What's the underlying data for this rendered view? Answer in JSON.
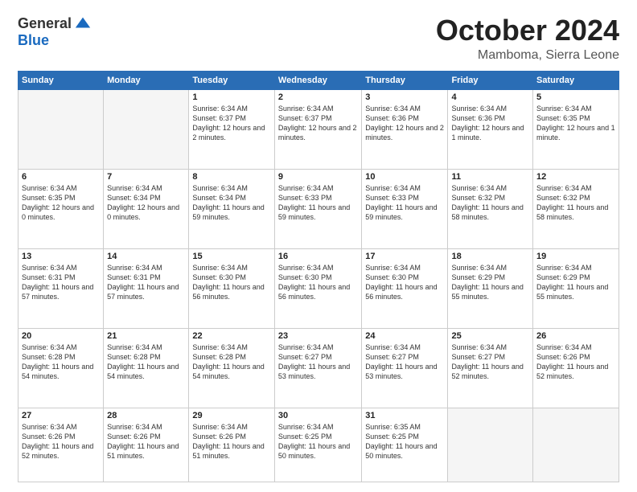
{
  "header": {
    "logo_general": "General",
    "logo_blue": "Blue",
    "month_title": "October 2024",
    "location": "Mamboma, Sierra Leone"
  },
  "days_of_week": [
    "Sunday",
    "Monday",
    "Tuesday",
    "Wednesday",
    "Thursday",
    "Friday",
    "Saturday"
  ],
  "weeks": [
    [
      {
        "day": "",
        "info": ""
      },
      {
        "day": "",
        "info": ""
      },
      {
        "day": "1",
        "info": "Sunrise: 6:34 AM\nSunset: 6:37 PM\nDaylight: 12 hours and 2 minutes."
      },
      {
        "day": "2",
        "info": "Sunrise: 6:34 AM\nSunset: 6:37 PM\nDaylight: 12 hours and 2 minutes."
      },
      {
        "day": "3",
        "info": "Sunrise: 6:34 AM\nSunset: 6:36 PM\nDaylight: 12 hours and 2 minutes."
      },
      {
        "day": "4",
        "info": "Sunrise: 6:34 AM\nSunset: 6:36 PM\nDaylight: 12 hours and 1 minute."
      },
      {
        "day": "5",
        "info": "Sunrise: 6:34 AM\nSunset: 6:35 PM\nDaylight: 12 hours and 1 minute."
      }
    ],
    [
      {
        "day": "6",
        "info": "Sunrise: 6:34 AM\nSunset: 6:35 PM\nDaylight: 12 hours and 0 minutes."
      },
      {
        "day": "7",
        "info": "Sunrise: 6:34 AM\nSunset: 6:34 PM\nDaylight: 12 hours and 0 minutes."
      },
      {
        "day": "8",
        "info": "Sunrise: 6:34 AM\nSunset: 6:34 PM\nDaylight: 11 hours and 59 minutes."
      },
      {
        "day": "9",
        "info": "Sunrise: 6:34 AM\nSunset: 6:33 PM\nDaylight: 11 hours and 59 minutes."
      },
      {
        "day": "10",
        "info": "Sunrise: 6:34 AM\nSunset: 6:33 PM\nDaylight: 11 hours and 59 minutes."
      },
      {
        "day": "11",
        "info": "Sunrise: 6:34 AM\nSunset: 6:32 PM\nDaylight: 11 hours and 58 minutes."
      },
      {
        "day": "12",
        "info": "Sunrise: 6:34 AM\nSunset: 6:32 PM\nDaylight: 11 hours and 58 minutes."
      }
    ],
    [
      {
        "day": "13",
        "info": "Sunrise: 6:34 AM\nSunset: 6:31 PM\nDaylight: 11 hours and 57 minutes."
      },
      {
        "day": "14",
        "info": "Sunrise: 6:34 AM\nSunset: 6:31 PM\nDaylight: 11 hours and 57 minutes."
      },
      {
        "day": "15",
        "info": "Sunrise: 6:34 AM\nSunset: 6:30 PM\nDaylight: 11 hours and 56 minutes."
      },
      {
        "day": "16",
        "info": "Sunrise: 6:34 AM\nSunset: 6:30 PM\nDaylight: 11 hours and 56 minutes."
      },
      {
        "day": "17",
        "info": "Sunrise: 6:34 AM\nSunset: 6:30 PM\nDaylight: 11 hours and 56 minutes."
      },
      {
        "day": "18",
        "info": "Sunrise: 6:34 AM\nSunset: 6:29 PM\nDaylight: 11 hours and 55 minutes."
      },
      {
        "day": "19",
        "info": "Sunrise: 6:34 AM\nSunset: 6:29 PM\nDaylight: 11 hours and 55 minutes."
      }
    ],
    [
      {
        "day": "20",
        "info": "Sunrise: 6:34 AM\nSunset: 6:28 PM\nDaylight: 11 hours and 54 minutes."
      },
      {
        "day": "21",
        "info": "Sunrise: 6:34 AM\nSunset: 6:28 PM\nDaylight: 11 hours and 54 minutes."
      },
      {
        "day": "22",
        "info": "Sunrise: 6:34 AM\nSunset: 6:28 PM\nDaylight: 11 hours and 54 minutes."
      },
      {
        "day": "23",
        "info": "Sunrise: 6:34 AM\nSunset: 6:27 PM\nDaylight: 11 hours and 53 minutes."
      },
      {
        "day": "24",
        "info": "Sunrise: 6:34 AM\nSunset: 6:27 PM\nDaylight: 11 hours and 53 minutes."
      },
      {
        "day": "25",
        "info": "Sunrise: 6:34 AM\nSunset: 6:27 PM\nDaylight: 11 hours and 52 minutes."
      },
      {
        "day": "26",
        "info": "Sunrise: 6:34 AM\nSunset: 6:26 PM\nDaylight: 11 hours and 52 minutes."
      }
    ],
    [
      {
        "day": "27",
        "info": "Sunrise: 6:34 AM\nSunset: 6:26 PM\nDaylight: 11 hours and 52 minutes."
      },
      {
        "day": "28",
        "info": "Sunrise: 6:34 AM\nSunset: 6:26 PM\nDaylight: 11 hours and 51 minutes."
      },
      {
        "day": "29",
        "info": "Sunrise: 6:34 AM\nSunset: 6:26 PM\nDaylight: 11 hours and 51 minutes."
      },
      {
        "day": "30",
        "info": "Sunrise: 6:34 AM\nSunset: 6:25 PM\nDaylight: 11 hours and 50 minutes."
      },
      {
        "day": "31",
        "info": "Sunrise: 6:35 AM\nSunset: 6:25 PM\nDaylight: 11 hours and 50 minutes."
      },
      {
        "day": "",
        "info": ""
      },
      {
        "day": "",
        "info": ""
      }
    ]
  ]
}
